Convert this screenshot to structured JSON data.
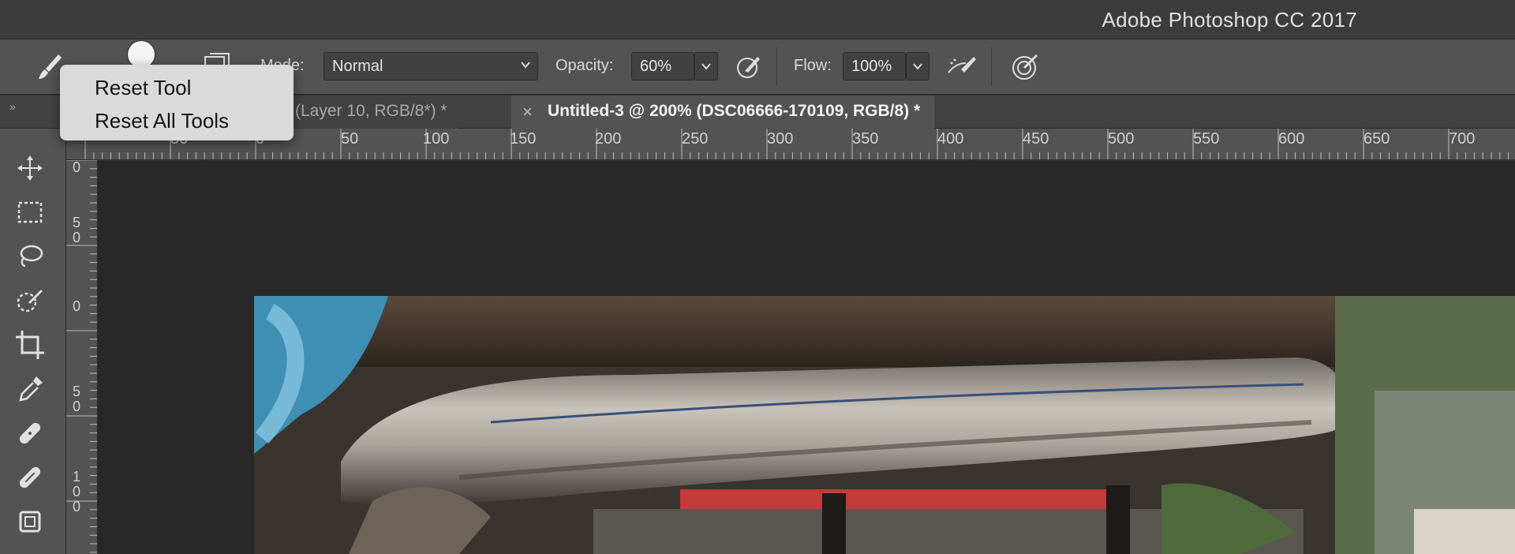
{
  "window": {
    "title": "Adobe Photoshop CC 2017"
  },
  "options_bar": {
    "mode_label": "Mode:",
    "mode_value": "Normal",
    "opacity_label": "Opacity:",
    "opacity_value": "60%",
    "flow_label": "Flow:",
    "flow_value": "100%"
  },
  "context_menu": {
    "items": [
      {
        "label": "Reset Tool"
      },
      {
        "label": "Reset All Tools"
      }
    ]
  },
  "tabs": [
    {
      "label": "(Layer 10, RGB/8*) *",
      "active": false
    },
    {
      "label": "Untitled-3 @ 200% (DSC06666-170109, RGB/8) *",
      "active": true,
      "close": "×"
    }
  ],
  "collapse_glyph": "»",
  "toolbar": {
    "tools": [
      "move-icon",
      "marquee-icon",
      "lasso-icon",
      "quick-selection-icon",
      "crop-icon",
      "eyedropper-icon",
      "healing-brush-icon",
      "brush-icon",
      "stamp-icon"
    ]
  },
  "rulers": {
    "horizontal_ticks": [
      "50",
      "0",
      "50",
      "100",
      "150",
      "200",
      "250",
      "300",
      "350",
      "400",
      "450",
      "500",
      "550",
      "600",
      "650",
      "700"
    ],
    "vertical_ticks": [
      "0",
      "5\n0",
      "0",
      "5\n0",
      "1\n0\n0"
    ]
  },
  "colors": {
    "accent": "#535353",
    "canvas_bg": "#282828",
    "menu_bg": "#dadada"
  }
}
